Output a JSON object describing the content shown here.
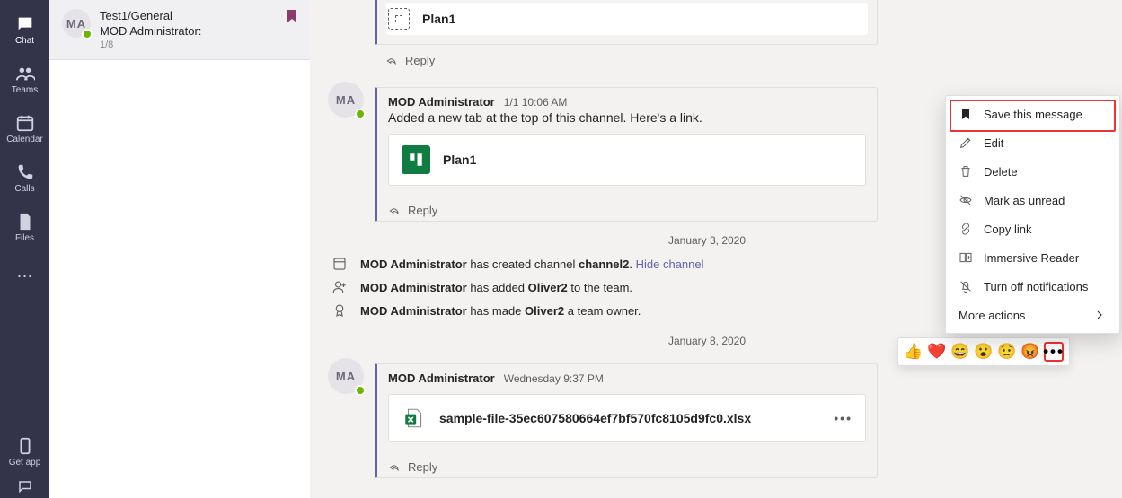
{
  "rail": {
    "items": [
      {
        "key": "chat",
        "label": "Chat"
      },
      {
        "key": "teams",
        "label": "Teams"
      },
      {
        "key": "calendar",
        "label": "Calendar"
      },
      {
        "key": "calls",
        "label": "Calls"
      },
      {
        "key": "files",
        "label": "Files"
      }
    ],
    "get_app": "Get app"
  },
  "list": {
    "rows": [
      {
        "avatar": "MA",
        "channel": "Test1/General",
        "preview": "MOD Administrator:",
        "date": "1/8",
        "bookmarked": true
      }
    ]
  },
  "conversation": {
    "card1_label": "Plan1",
    "reply_label": "Reply",
    "msg2": {
      "author": "MOD Administrator",
      "time": "1/1 10:06 AM",
      "text": "Added a new tab at the top of this channel. Here's a link.",
      "attachment": "Plan1"
    },
    "date1": "January 3, 2020",
    "sys1": {
      "actor": "MOD Administrator",
      "mid": " has created channel ",
      "subject": "channel2",
      "link": "Hide channel",
      "after": ". "
    },
    "sys2": {
      "actor": "MOD Administrator",
      "mid": " has added ",
      "subject": "Oliver2",
      "after": " to the team."
    },
    "sys3": {
      "actor": "MOD Administrator",
      "mid": " has made ",
      "subject": "Oliver2",
      "after": " a team owner."
    },
    "date2": "January 8, 2020",
    "msg3": {
      "author": "MOD Administrator",
      "time": "Wednesday 9:37 PM",
      "attachment": "sample-file-35ec607580664ef7bf570fc8105d9fc0.xlsx"
    }
  },
  "reactions": {
    "items": [
      "👍",
      "❤️",
      "😄",
      "😮",
      "😟",
      "😡"
    ],
    "more": "•••"
  },
  "context_menu": {
    "save": "Save this message",
    "edit": "Edit",
    "delete": "Delete",
    "unread": "Mark as unread",
    "copy": "Copy link",
    "reader": "Immersive Reader",
    "turnoff": "Turn off notifications",
    "more": "More actions"
  }
}
